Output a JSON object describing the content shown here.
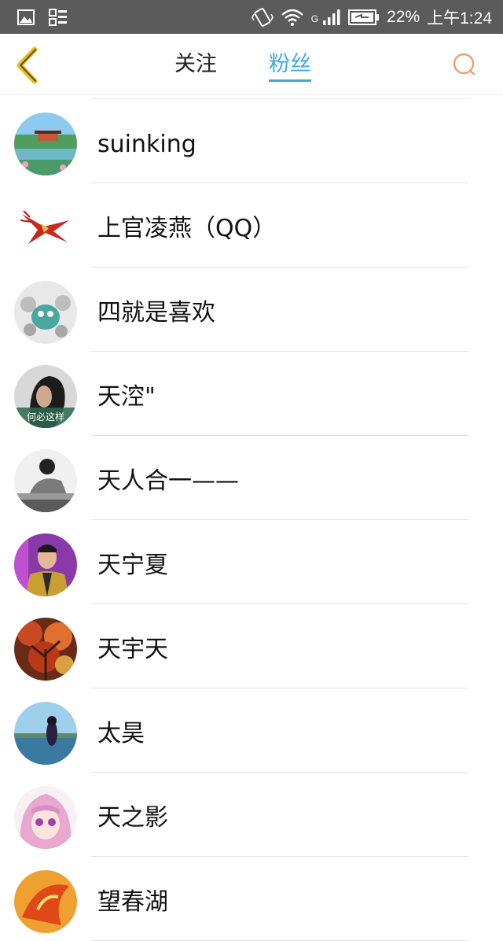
{
  "status_bar": {
    "network_label": "G",
    "battery_percent": "22%",
    "time": "上午1:24"
  },
  "header": {
    "tabs": [
      {
        "label": "关注",
        "active": false
      },
      {
        "label": "粉丝",
        "active": true
      }
    ],
    "accent_color": "#3fa6e0",
    "back_icon": "chevron-left-icon",
    "search_icon": "search-icon"
  },
  "fans": [
    {
      "name": "suinking",
      "avatar": "lake-pavilion"
    },
    {
      "name": "上官凌燕（QQ）",
      "avatar": "red-phoenix"
    },
    {
      "name": "四就是喜欢",
      "avatar": "cartoon-creature"
    },
    {
      "name": "天涳\"",
      "avatar": "girl-dark-hair",
      "avatar_caption": "何必这样"
    },
    {
      "name": "天人合一——",
      "avatar": "bw-portrait"
    },
    {
      "name": "天宁夏",
      "avatar": "man-portrait"
    },
    {
      "name": "天宇天",
      "avatar": "autumn-tree"
    },
    {
      "name": "太昊",
      "avatar": "girl-lake"
    },
    {
      "name": "天之影",
      "avatar": "anime-girl"
    },
    {
      "name": "望春湖",
      "avatar": "orange-bird"
    }
  ]
}
